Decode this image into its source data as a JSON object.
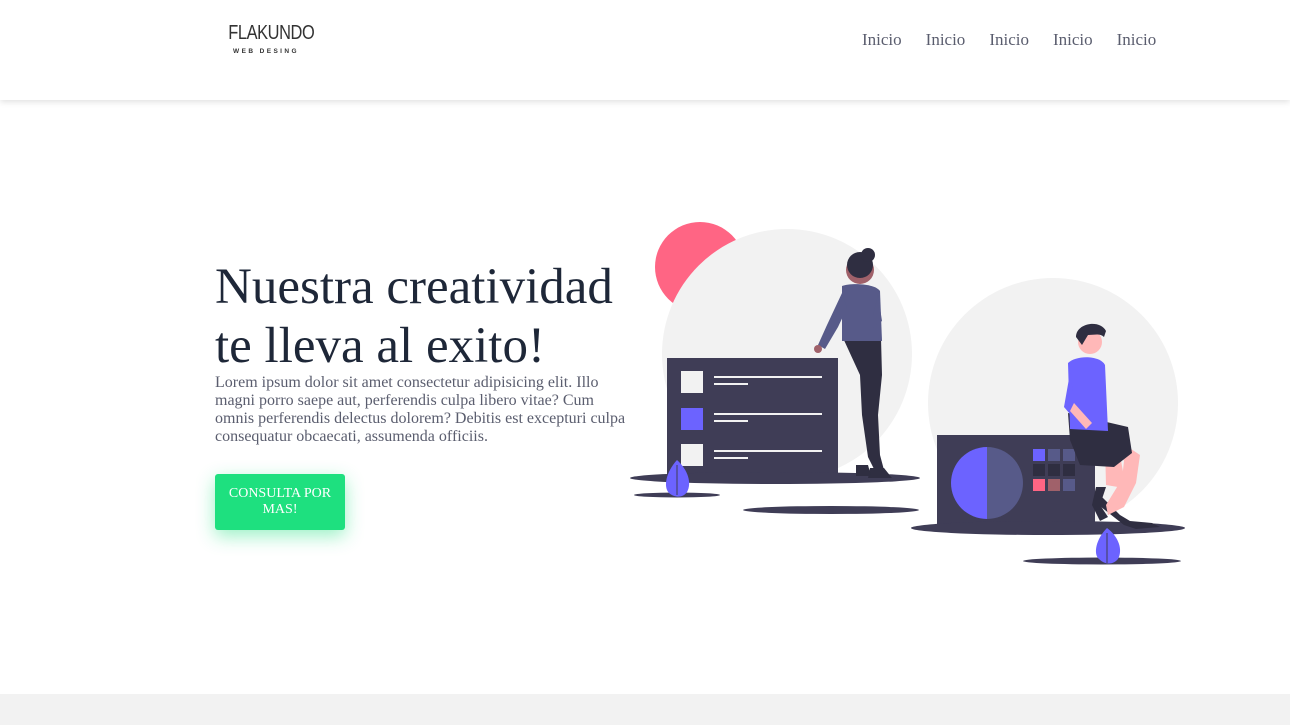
{
  "header": {
    "logo": {
      "name": "FLAKUNDO",
      "tagline": "WEB DESING"
    },
    "nav": [
      "Inicio",
      "Inicio",
      "Inicio",
      "Inicio",
      "Inicio"
    ]
  },
  "hero": {
    "title": "Nuestra creatividad te lleva al exito!",
    "text": "Lorem ipsum dolor sit amet consectetur adipisicing elit. Illo magni porro saepe aut, perferendis culpa libero vitae? Cum omnis perferendis delectus dolorem? Debitis est excepturi culpa consequatur obcaecati, assumenda officiis.",
    "cta_label": "CONSULTA POR MAS!"
  },
  "colors": {
    "accent": "#1ee07f",
    "illustration_purple": "#6c63ff",
    "illustration_pink": "#ff6584",
    "illustration_dark": "#3f3d56"
  }
}
